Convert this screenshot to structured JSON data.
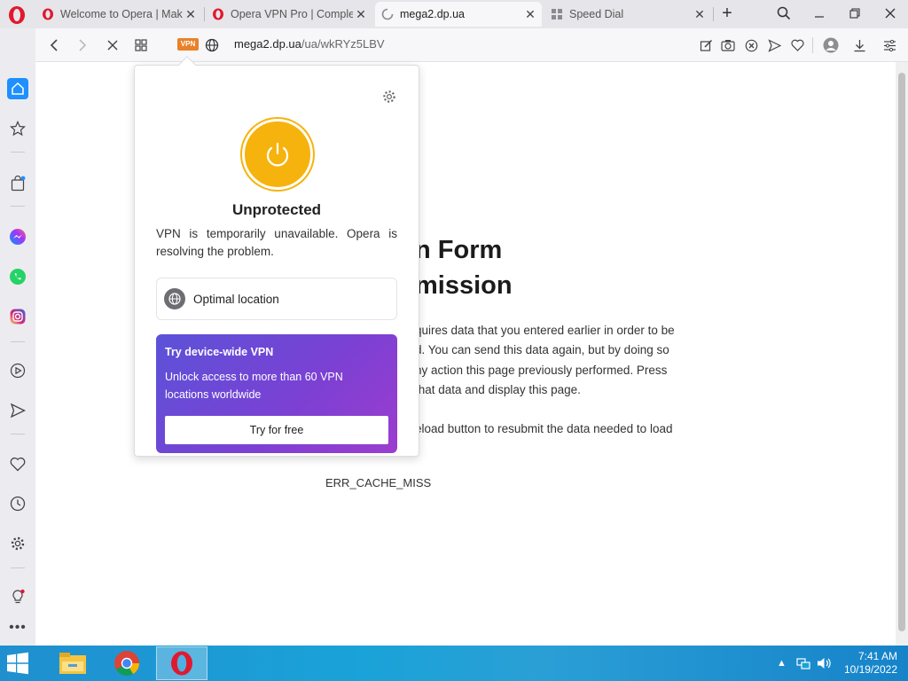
{
  "browser": {
    "tabs": [
      {
        "title": "Welcome to Opera | Make",
        "favicon": "opera-icon"
      },
      {
        "title": "Opera VPN Pro | Complet",
        "favicon": "opera-icon"
      },
      {
        "title": "mega2.dp.ua",
        "favicon": "loading-icon"
      },
      {
        "title": "Speed Dial",
        "favicon": "speed-dial-icon"
      }
    ],
    "new_tab_label": "+",
    "url_host": "mega2.dp.ua",
    "url_path": "/ua/wkRYz5LBV",
    "vpn_badge": "VPN"
  },
  "page": {
    "heading_line1": "n Form",
    "heading_line2": "mission",
    "para_lines": [
      "quires data that you entered earlier in order to be",
      "d. You can send this data again, but by doing so",
      "ny action this page previously performed. Press",
      "that data and display this page."
    ],
    "reload_line": "eload button to resubmit the data needed to load",
    "error_code": "ERR_CACHE_MISS"
  },
  "vpn_popup": {
    "status": "Unprotected",
    "message": "VPN is temporarily unavailable. Opera is resolving the problem.",
    "location_label": "Optimal location",
    "promo_title": "Try device-wide VPN",
    "promo_desc": "Unlock access to more than 60 VPN locations worldwide",
    "promo_button": "Try for free"
  },
  "taskbar": {
    "time": "7:41 AM",
    "date": "10/19/2022"
  },
  "colors": {
    "accent": "#f6b30e",
    "vpn_badge": "#e8822a",
    "promo_start": "#5b52d8",
    "promo_end": "#9c3dcf",
    "opera_red": "#e0192f"
  }
}
